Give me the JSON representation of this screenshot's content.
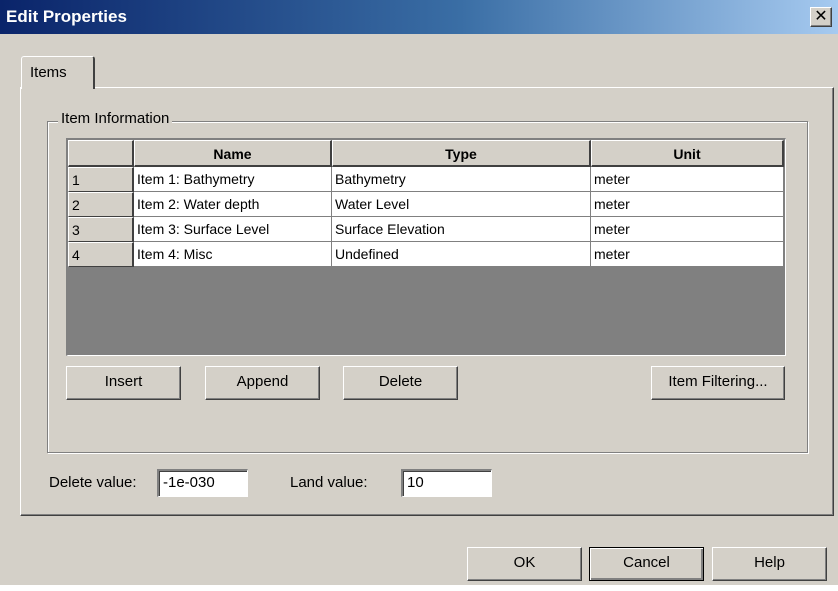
{
  "window": {
    "title": "Edit Properties",
    "close_glyph": "✕"
  },
  "tabs": [
    {
      "label": "Items",
      "selected": true
    }
  ],
  "item_info": {
    "group_label": "Item Information",
    "columns": [
      "Name",
      "Type",
      "Unit"
    ],
    "rows": [
      {
        "index": "1",
        "name": "Item 1: Bathymetry",
        "type": "Bathymetry",
        "unit": "meter"
      },
      {
        "index": "2",
        "name": "Item 2: Water depth",
        "type": "Water Level",
        "unit": "meter"
      },
      {
        "index": "3",
        "name": "Item 3: Surface Level",
        "type": "Surface Elevation",
        "unit": "meter"
      },
      {
        "index": "4",
        "name": "Item 4: Misc",
        "type": "Undefined",
        "unit": "meter"
      }
    ],
    "buttons": {
      "insert": "Insert",
      "append": "Append",
      "delete": "Delete",
      "filtering": "Item Filtering..."
    }
  },
  "fields": {
    "delete_value_label": "Delete value:",
    "delete_value": "-1e-030",
    "land_value_label": "Land value:",
    "land_value": "10"
  },
  "footer": {
    "ok": "OK",
    "cancel": "Cancel",
    "help": "Help"
  },
  "colors": {
    "face": "#d4d0c8",
    "titlebar_start": "#0a246a",
    "titlebar_end": "#a6caf0"
  }
}
